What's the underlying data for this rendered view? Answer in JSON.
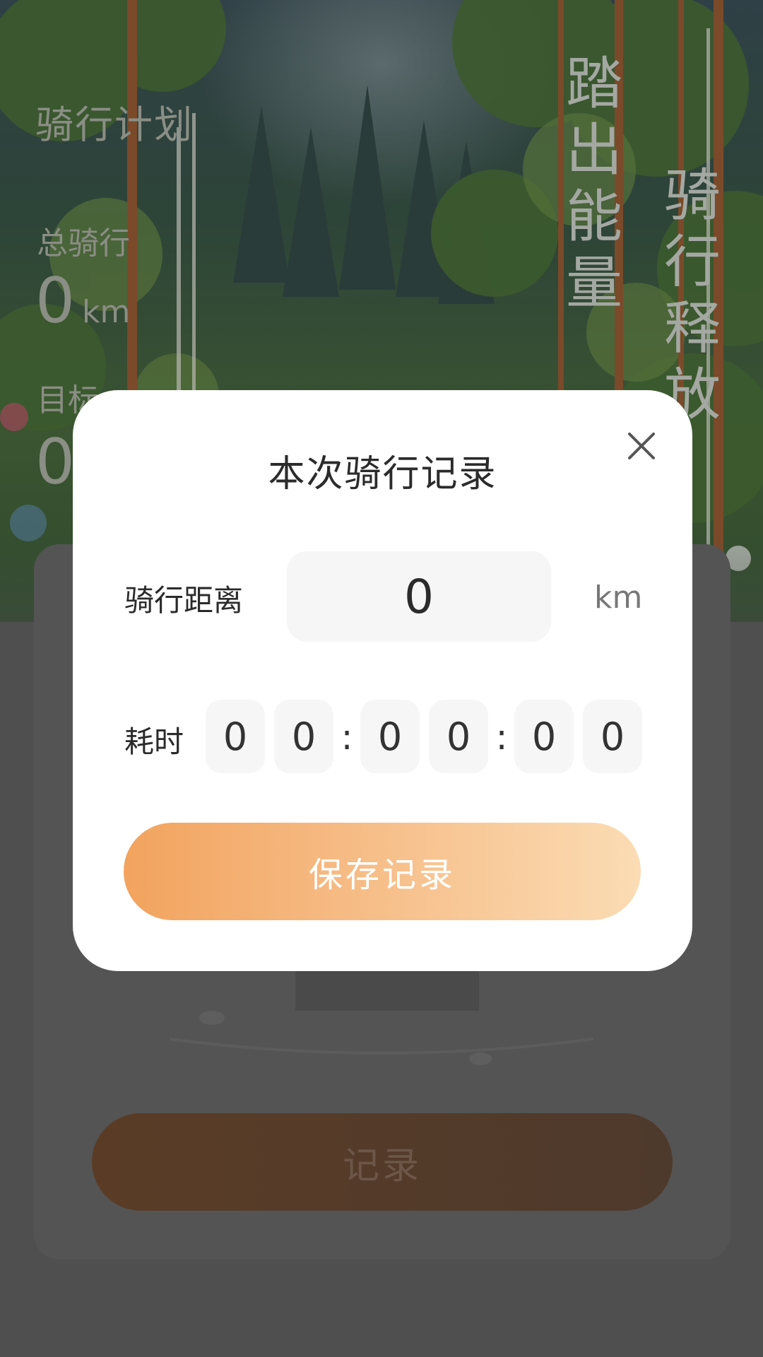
{
  "background_page": {
    "plan_title": "骑行计划",
    "total_label": "总骑行",
    "total_value": "0",
    "total_unit": "km",
    "target_label": "目标",
    "target_value": "0",
    "slogan_line1": "踏出能量",
    "slogan_line2": "骑行释放",
    "record_button_label": "记录"
  },
  "modal": {
    "title": "本次骑行记录",
    "distance_label": "骑行距离",
    "distance_value": "0",
    "distance_unit": "km",
    "time_label": "耗时",
    "time_digits": [
      "0",
      "0",
      "0",
      "0",
      "0",
      "0"
    ],
    "time_separator": ":",
    "save_button_label": "保存记录"
  },
  "colors": {
    "accent_start": "#f2a35e",
    "accent_end": "#fbdcb4",
    "overlay": "#4a4a4a"
  }
}
